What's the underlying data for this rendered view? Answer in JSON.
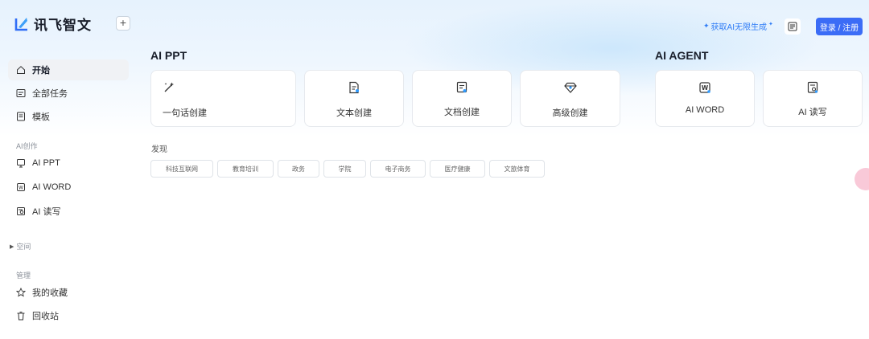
{
  "brand": {
    "name": "讯飞智文",
    "accent": "#3b6cf6"
  },
  "topbar": {
    "promo_text": "获取AI无限生成",
    "login_label": "登录 / 注册"
  },
  "sidebar": {
    "main": [
      {
        "label": "开始",
        "icon": "home-icon",
        "active": true
      },
      {
        "label": "全部任务",
        "icon": "tasks-icon"
      },
      {
        "label": "模板",
        "icon": "template-icon"
      }
    ],
    "ai_section_label": "AI创作",
    "ai_items": [
      {
        "label": "AI PPT",
        "icon": "ppt-icon"
      },
      {
        "label": "AI WORD",
        "icon": "word-icon"
      },
      {
        "label": "AI 读写",
        "icon": "read-write-icon"
      }
    ],
    "space_label": "空间",
    "manage_label": "管理",
    "manage_items": [
      {
        "label": "我的收藏",
        "icon": "star-icon"
      },
      {
        "label": "回收站",
        "icon": "trash-icon"
      }
    ]
  },
  "main": {
    "ppt_heading": "AI PPT",
    "agent_heading": "AI AGENT",
    "ppt_cards": [
      {
        "label": "一句话创建",
        "icon": "magic-wand-icon"
      },
      {
        "label": "文本创建",
        "icon": "text-doc-icon"
      },
      {
        "label": "文档创建",
        "icon": "doc-upload-icon"
      },
      {
        "label": "高级创建",
        "icon": "diamond-icon"
      }
    ],
    "agent_cards": [
      {
        "label": "AI WORD",
        "icon": "word-doc-icon"
      },
      {
        "label": "AI 读写",
        "icon": "read-doc-icon"
      }
    ],
    "discover_label": "发现",
    "tags": [
      "科技互联网",
      "教育培训",
      "政务",
      "学院",
      "电子商务",
      "医疗健康",
      "文旅体育"
    ]
  }
}
